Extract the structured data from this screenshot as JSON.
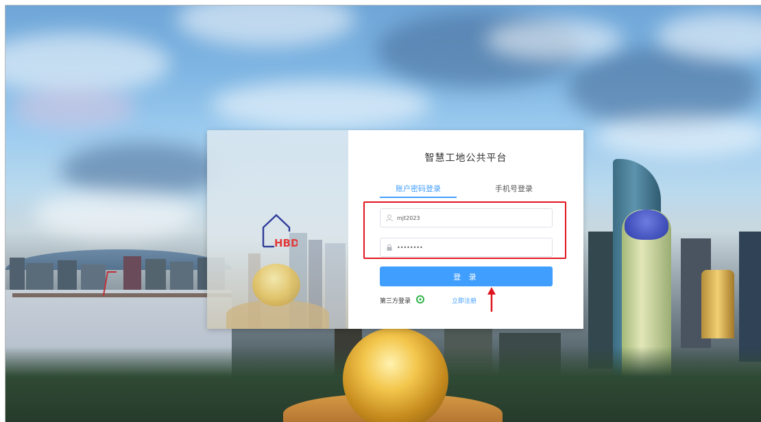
{
  "background": {
    "scene": "city skyline at dusk"
  },
  "login_card": {
    "title": "智慧工地公共平台",
    "tabs": [
      {
        "label": "账户密码登录",
        "active": true
      },
      {
        "label": "手机号登录",
        "active": false
      }
    ],
    "username": {
      "value": "mjt2023",
      "icon": "user-icon"
    },
    "password": {
      "value": "••••••••",
      "icon": "lock-icon"
    },
    "login_label": "登 录",
    "third_party_label": "第三方登录",
    "third_party_icon": "wechat-icon",
    "register_label": "立即注册"
  },
  "colors": {
    "accent": "#409eff",
    "highlight": "#e0141e",
    "logo_blue": "#2d3b9a",
    "logo_red": "#e23a3a"
  }
}
